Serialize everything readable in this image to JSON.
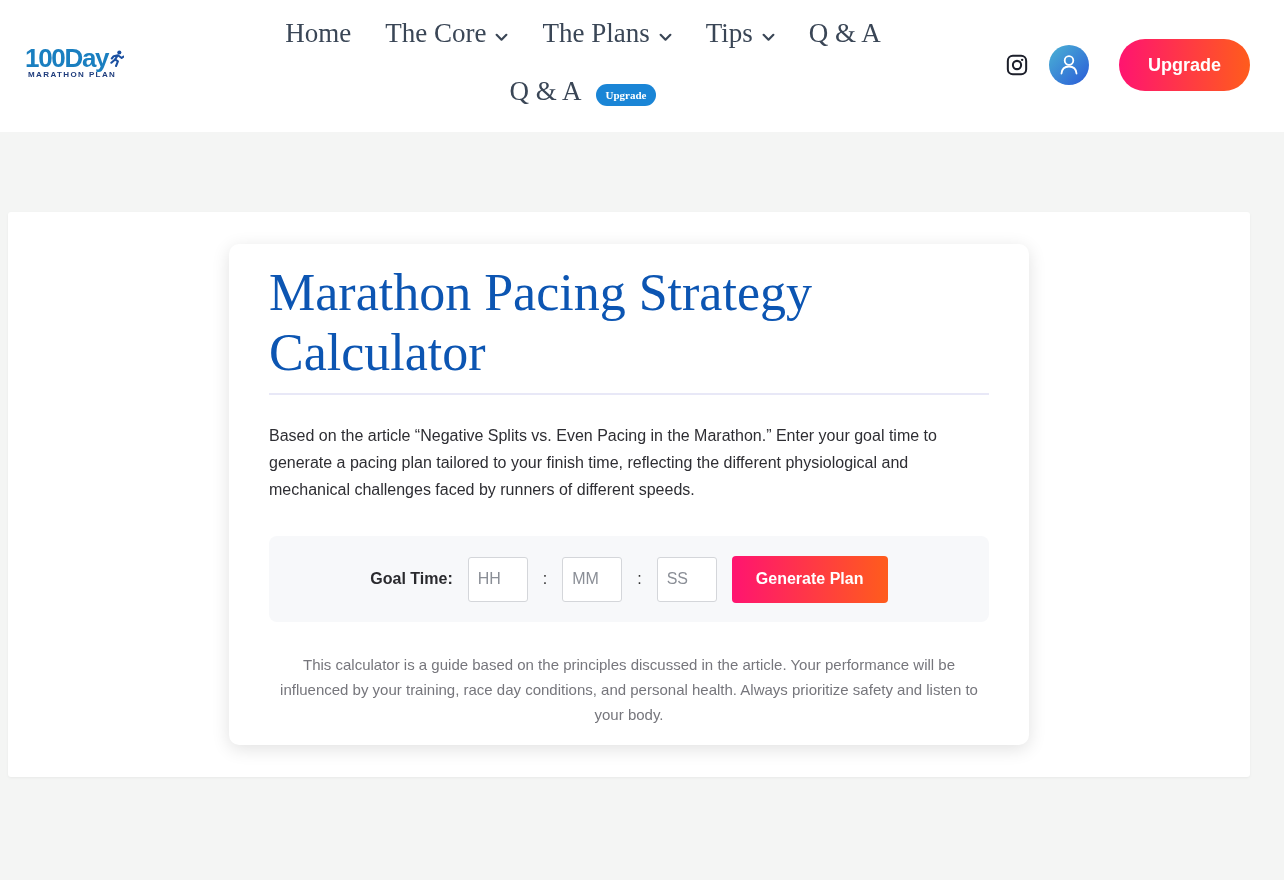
{
  "header": {
    "logo": {
      "wordmark": "100Day",
      "tagline": "MARATHON PLAN"
    },
    "nav": [
      {
        "label": "Home",
        "dropdown": false
      },
      {
        "label": "The Core",
        "dropdown": true
      },
      {
        "label": "The Plans",
        "dropdown": true
      },
      {
        "label": "Tips",
        "dropdown": true
      },
      {
        "label": "Q & A",
        "dropdown": false
      },
      {
        "label": "Q & A",
        "dropdown": false,
        "badge": "Upgrade"
      }
    ],
    "upgrade_button": "Upgrade"
  },
  "calculator": {
    "title": "Marathon Pacing Strategy Calculator",
    "description": "Based on the article “Negative Splits vs. Even Pacing in the Marathon.” Enter your goal time to generate a pacing plan tailored to your finish time, reflecting the different physiological and mechanical challenges faced by runners of different speeds.",
    "goal_time": {
      "label": "Goal Time:",
      "fields": [
        {
          "placeholder": "HH"
        },
        {
          "placeholder": "MM"
        },
        {
          "placeholder": "SS"
        }
      ],
      "separators": [
        ":",
        ":"
      ],
      "button": "Generate Plan"
    },
    "disclaimer": "This calculator is a guide based on the principles discussed in the article. Your performance will be influenced by your training, race day conditions, and personal health. Always prioritize safety and listen to your body."
  }
}
